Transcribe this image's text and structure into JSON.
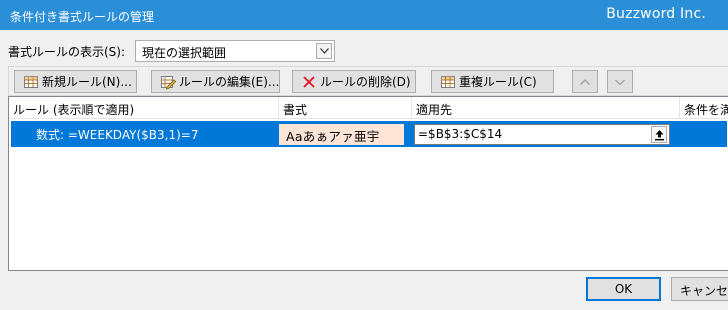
{
  "window": {
    "title": "条件付き書式ルールの管理",
    "brand": "Buzzword Inc."
  },
  "show_rules": {
    "label": "書式ルールの表示(S):",
    "selected": "現在の選択範囲"
  },
  "toolbar": {
    "new_rule": "新規ルール(N)...",
    "edit_rule": "ルールの編集(E)...",
    "delete_rule": "ルールの削除(D)",
    "duplicate_rule": "重複ルール(C)"
  },
  "table": {
    "headers": [
      "ルール (表示順で適用)",
      "書式",
      "適用先",
      "条件を満"
    ],
    "rows": [
      {
        "rule": "数式: =WEEKDAY($B3,1)=7",
        "format_preview": "Aaあぁアァ亜宇",
        "applies_to": "=$B$3:$C$14"
      }
    ]
  },
  "footer": {
    "ok": "OK",
    "cancel": "キャンセル"
  },
  "colors": {
    "titlebar": "#2b8fd8",
    "selection": "#0078d7",
    "format_fill": "#fce4d6",
    "delete_icon": "#e81123"
  }
}
